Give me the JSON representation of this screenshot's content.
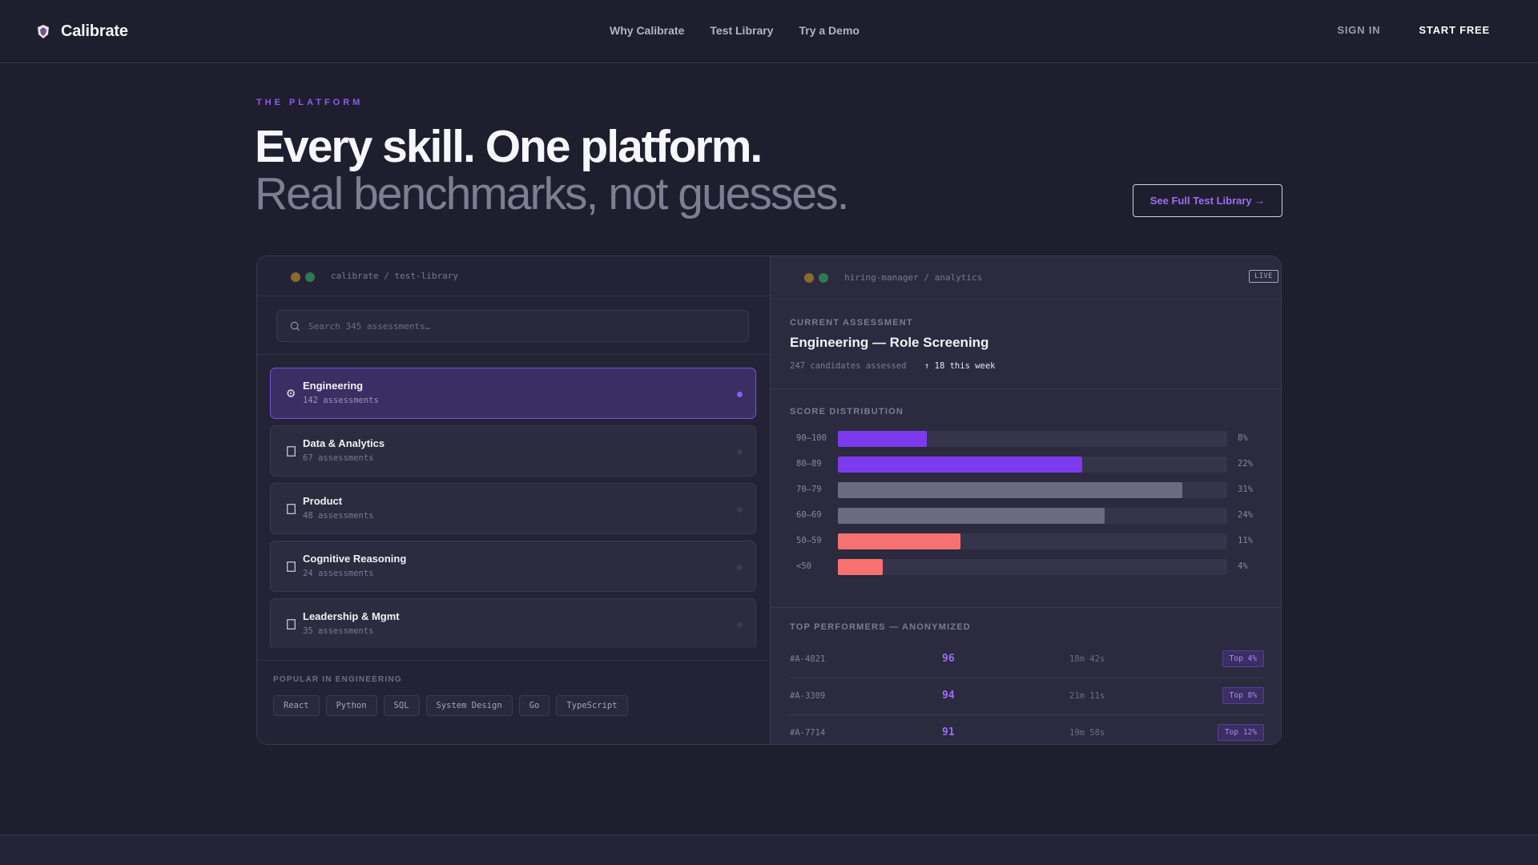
{
  "brand": {
    "name": "Calibrate",
    "logo_icon": "badge-logo-icon"
  },
  "nav": {
    "links": [
      "Why Calibrate",
      "Test Library",
      "Try a Demo"
    ],
    "sign_in": "SIGN IN",
    "start_free": "START FREE"
  },
  "hero": {
    "eyebrow": "THE PLATFORM",
    "line1": "Every skill. One platform.",
    "line2": "Real benchmarks, not guesses.",
    "cta": "See Full Test Library →"
  },
  "library_window": {
    "path": "calibrate / test-library",
    "search_placeholder": "Search 345 assessments…",
    "categories": [
      {
        "name": "Engineering",
        "count": "142 assessments",
        "icon": "gear-icon",
        "active": true
      },
      {
        "name": "Data & Analytics",
        "count": "67 assessments",
        "icon": "square-icon",
        "active": false
      },
      {
        "name": "Product",
        "count": "48 assessments",
        "icon": "square-icon",
        "active": false
      },
      {
        "name": "Cognitive Reasoning",
        "count": "24 assessments",
        "icon": "square-icon",
        "active": false
      },
      {
        "name": "Leadership & Mgmt",
        "count": "35 assessments",
        "icon": "square-icon",
        "active": false
      }
    ],
    "popular_title": "POPULAR IN ENGINEERING",
    "tags": [
      "React",
      "Python",
      "SQL",
      "System Design",
      "Go",
      "TypeScript"
    ]
  },
  "analytics_window": {
    "path": "hiring-manager / analytics",
    "live_badge": "LIVE",
    "current_label": "CURRENT ASSESSMENT",
    "current_title": "Engineering — Role Screening",
    "candidates": "247 candidates assessed",
    "weekly": "↑ 18 this week",
    "distribution_label": "SCORE DISTRIBUTION",
    "distribution": [
      {
        "range": "90–100",
        "percent": 8,
        "label": "8%",
        "color": "#7c3aed"
      },
      {
        "range": "80–89",
        "percent": 22,
        "label": "22%",
        "color": "#7c3aed"
      },
      {
        "range": "70–79",
        "percent": 31,
        "label": "31%",
        "color": "#6b6a80"
      },
      {
        "range": "60–69",
        "percent": 24,
        "label": "24%",
        "color": "#6b6a80"
      },
      {
        "range": "50–59",
        "percent": 11,
        "label": "11%",
        "color": "#f87171"
      },
      {
        "range": "<50",
        "percent": 4,
        "label": "4%",
        "color": "#f87171"
      }
    ],
    "performers_label": "TOP PERFORMERS — ANONYMIZED",
    "performers": [
      {
        "id": "#A-4821",
        "score": "96",
        "time": "18m 42s",
        "badge": "Top 4%"
      },
      {
        "id": "#A-3309",
        "score": "94",
        "time": "21m 11s",
        "badge": "Top 8%"
      },
      {
        "id": "#A-7714",
        "score": "91",
        "time": "19m 58s",
        "badge": "Top 12%"
      }
    ]
  },
  "colors": {
    "background": "#1f1e2e",
    "accent": "#7c3aed",
    "accent_text": "#9a6ef5",
    "danger": "#f87171"
  }
}
